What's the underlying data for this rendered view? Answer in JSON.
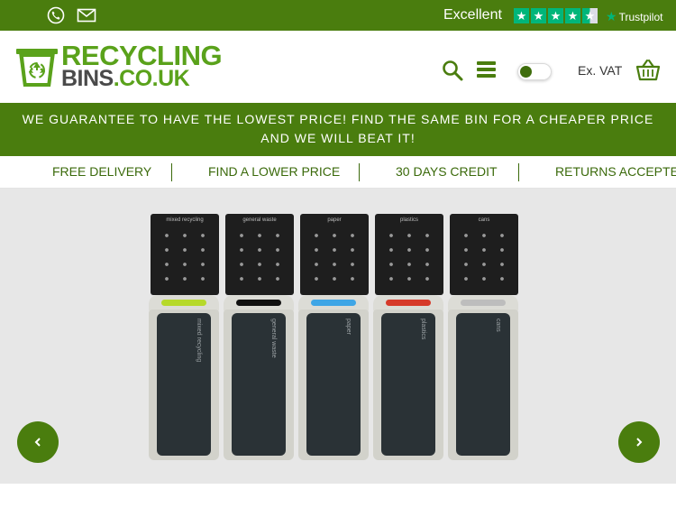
{
  "topbar": {
    "phone_icon": "phone-icon",
    "mail_icon": "mail-icon",
    "rating_text": "Excellent",
    "stars": 4.5,
    "trustpilot_label": "Trustpilot"
  },
  "header": {
    "logo_line1": "RECYCLING",
    "logo_line2_a": "BINS",
    "logo_line2_b": ".CO.UK",
    "vat_label": "Ex. VAT"
  },
  "promo": {
    "line1": "WE GUARANTEE TO HAVE THE LOWEST PRICE! FIND THE SAME BIN FOR A CHEAPER PRICE",
    "line2": "AND WE WILL BEAT IT!"
  },
  "usp": [
    "FREE DELIVERY",
    "FIND A LOWER PRICE",
    "30 DAYS CREDIT",
    "RETURNS ACCEPTED"
  ],
  "hero": {
    "bins": [
      {
        "sign": "mixed recycling",
        "label": "mixed recycling",
        "slot_color": "#b6d92a"
      },
      {
        "sign": "general waste",
        "label": "general waste",
        "slot_color": "#111111"
      },
      {
        "sign": "paper",
        "label": "paper",
        "slot_color": "#3fa6e6"
      },
      {
        "sign": "plastics",
        "label": "plastics",
        "slot_color": "#d63a2a"
      },
      {
        "sign": "cans",
        "label": "cans",
        "slot_color": "#bdbdbd"
      }
    ],
    "prev_icon": "chevron-left-icon",
    "next_icon": "chevron-right-icon"
  },
  "colors": {
    "brand_green": "#4a7d0e",
    "logo_green": "#5aa21b",
    "trustpilot_green": "#00b67a"
  }
}
